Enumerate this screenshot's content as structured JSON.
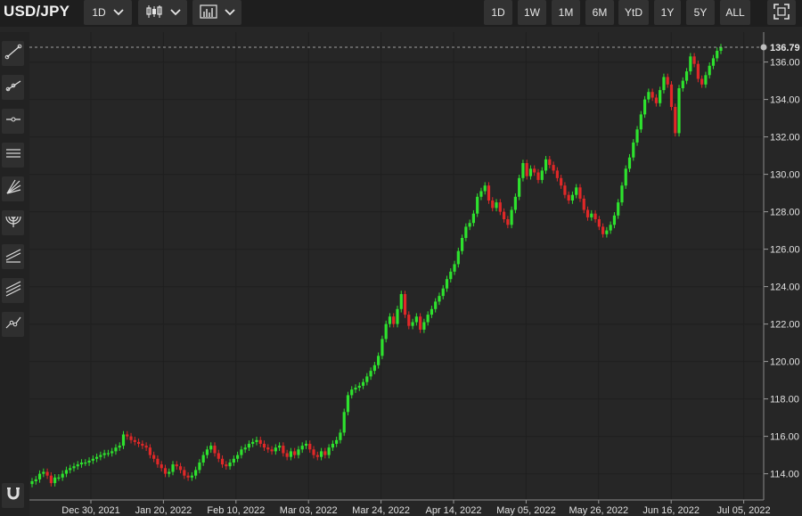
{
  "toolbar": {
    "symbol": "USD/JPY",
    "interval_label": "1D",
    "chart_style_icon": "candlestick-icon",
    "indicator_icon": "indicator-chart-icon",
    "ranges": [
      "1D",
      "1W",
      "1M",
      "6M",
      "YtD",
      "1Y",
      "5Y",
      "ALL"
    ],
    "fullscreen_icon": "fullscreen-icon"
  },
  "sidebar": {
    "tools": [
      "trend-line-icon",
      "ray-line-icon",
      "horizontal-line-icon",
      "parallel-channel-icon",
      "fan-lines-icon",
      "fibonacci-arc-icon",
      "regression-channel-icon",
      "pitchfork-icon",
      "polyline-icon"
    ],
    "bottom_tool": "magnet-icon"
  },
  "colors": {
    "background": "#262626",
    "up": "#2ee22e",
    "down": "#e02828",
    "grid": "#1f1f1f",
    "last_price_line": "#a0a0a0"
  },
  "chart_data": {
    "type": "candlestick",
    "title": "USD/JPY",
    "ylim": [
      112.6,
      137.6
    ],
    "y_ticks": [
      "114.00",
      "116.00",
      "118.00",
      "120.00",
      "122.00",
      "124.00",
      "126.00",
      "128.00",
      "130.00",
      "132.00",
      "134.00",
      "136.00"
    ],
    "x_ticks": [
      "Dec 30, 2021",
      "Jan 20, 2022",
      "Feb 10, 2022",
      "Mar 03, 2022",
      "Mar 24, 2022",
      "Apr 14, 2022",
      "May 05, 2022",
      "May 26, 2022",
      "Jun 16, 2022",
      "Jul 05, 2022"
    ],
    "last_price": "136.79",
    "grid": true,
    "series": [
      {
        "values": [
          113.6,
          113.7,
          114.0,
          114.1,
          113.9,
          113.5,
          113.8,
          113.8,
          114.0,
          114.2,
          114.3,
          114.4,
          114.5,
          114.6,
          114.6,
          114.7,
          114.8,
          114.9,
          115.0,
          115.1,
          115.1,
          115.2,
          115.4,
          115.5,
          116.1,
          116.0,
          115.8,
          115.7,
          115.6,
          115.5,
          115.4,
          115.0,
          114.8,
          114.5,
          114.3,
          114.0,
          114.1,
          114.5,
          114.4,
          114.2,
          113.9,
          113.8,
          113.9,
          114.2,
          114.6,
          115.0,
          115.3,
          115.5,
          115.1,
          114.8,
          114.5,
          114.4,
          114.6,
          114.8,
          115.0,
          115.3,
          115.4,
          115.6,
          115.7,
          115.8,
          115.6,
          115.4,
          115.3,
          115.2,
          115.4,
          115.5,
          115.1,
          114.9,
          115.2,
          115.0,
          115.3,
          115.5,
          115.6,
          115.3,
          115.0,
          114.9,
          115.2,
          115.0,
          115.4,
          115.6,
          115.8,
          116.2,
          117.3,
          118.2,
          118.5,
          118.6,
          118.7,
          118.9,
          119.2,
          119.5,
          119.8,
          120.3,
          121.2,
          122.0,
          122.4,
          122.0,
          122.8,
          123.6,
          122.5,
          121.9,
          122.1,
          122.4,
          121.7,
          122.1,
          122.5,
          122.8,
          123.2,
          123.5,
          123.9,
          124.4,
          124.8,
          125.2,
          125.9,
          126.6,
          127.2,
          127.4,
          127.9,
          128.8,
          129.1,
          129.4,
          128.6,
          128.2,
          128.5,
          128.0,
          127.6,
          127.3,
          128.1,
          128.8,
          129.8,
          130.6,
          129.9,
          130.3,
          130.1,
          129.7,
          130.2,
          130.8,
          130.5,
          130.2,
          129.8,
          129.4,
          128.9,
          128.6,
          128.9,
          129.3,
          128.7,
          128.1,
          127.7,
          127.9,
          127.6,
          127.2,
          126.8,
          127.0,
          127.3,
          127.8,
          128.5,
          129.4,
          130.3,
          130.9,
          131.7,
          132.4,
          133.2,
          134.0,
          134.4,
          134.1,
          133.8,
          134.5,
          135.2,
          134.8,
          133.6,
          132.2,
          134.6,
          135.0,
          135.5,
          136.3,
          135.9,
          135.1,
          134.8,
          135.3,
          135.8,
          136.2,
          136.6,
          136.79
        ]
      }
    ]
  }
}
